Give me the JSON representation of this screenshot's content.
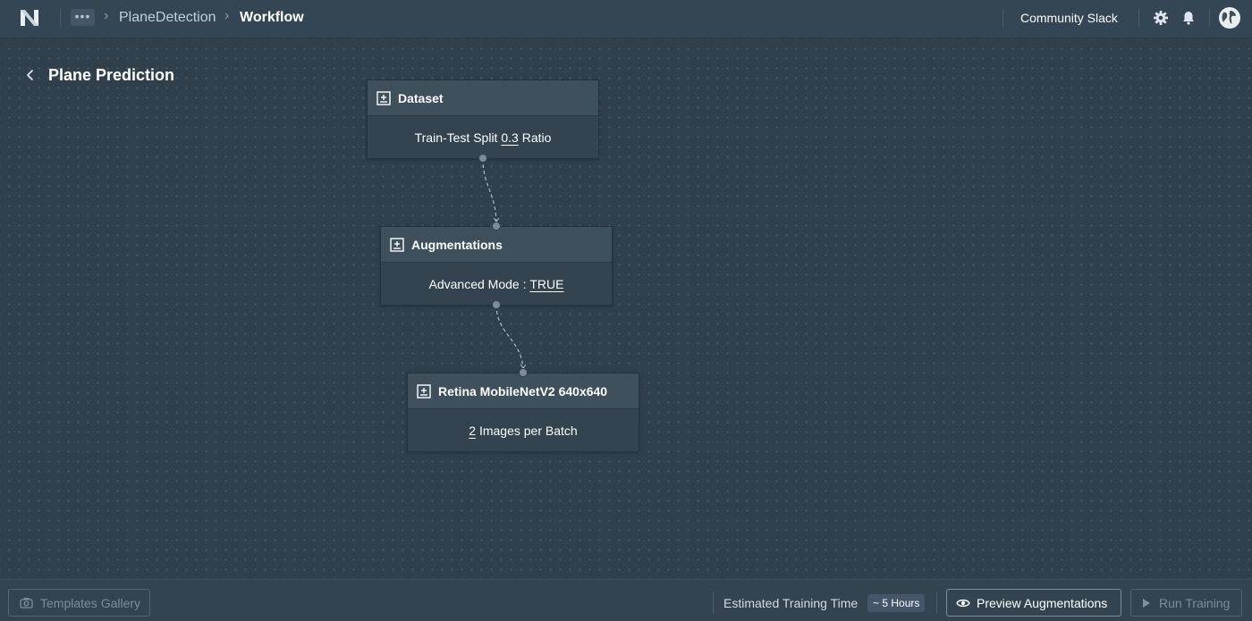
{
  "header": {
    "more_label": "•••",
    "breadcrumb": {
      "project": "PlaneDetection",
      "current": "Workflow"
    },
    "community_link": "Community Slack",
    "icons": [
      "logo-icon",
      "gear-icon",
      "bell-icon",
      "globe-avatar-icon"
    ]
  },
  "page": {
    "title": "Plane Prediction"
  },
  "nodes": [
    {
      "title": "Dataset",
      "body_prefix": "Train-Test Split ",
      "body_value": "0.3",
      "body_suffix": " Ratio"
    },
    {
      "title": "Augmentations",
      "body_prefix": "Advanced Mode : ",
      "body_value": "TRUE",
      "body_suffix": ""
    },
    {
      "title": "Retina MobileNetV2 640x640",
      "body_prefix": "",
      "body_value": "2",
      "body_suffix": " Images per Batch"
    }
  ],
  "footer": {
    "templates_label": "Templates Gallery",
    "estimate_label": "Estimated Training Time",
    "estimate_value": "~ 5 Hours",
    "preview_label": "Preview Augmentations",
    "run_label": "Run Training"
  },
  "colors": {
    "background": "#2f3f4c",
    "topbar": "#344553",
    "node_header": "#3f505d",
    "node_body": "#33434f",
    "connector": "#aebbc4"
  }
}
